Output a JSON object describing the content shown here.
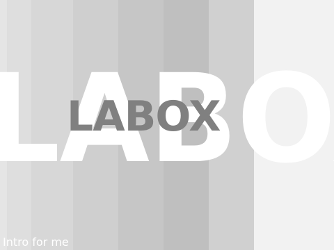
{
  "scene": {
    "big_logo_text": "LABOX",
    "small_logo_text": "LABOX",
    "caption": "Intro for me"
  },
  "colors": {
    "big_logo": "#ffffff",
    "small_logo": "#808080",
    "caption": "#ffffff",
    "stripes": [
      "#e5e5e5",
      "#dedede",
      "#d7d7d7",
      "#cfcfcf",
      "#c6c6c6",
      "#bfbfbf",
      "#d0d0d0",
      "#f2f2f2"
    ]
  }
}
